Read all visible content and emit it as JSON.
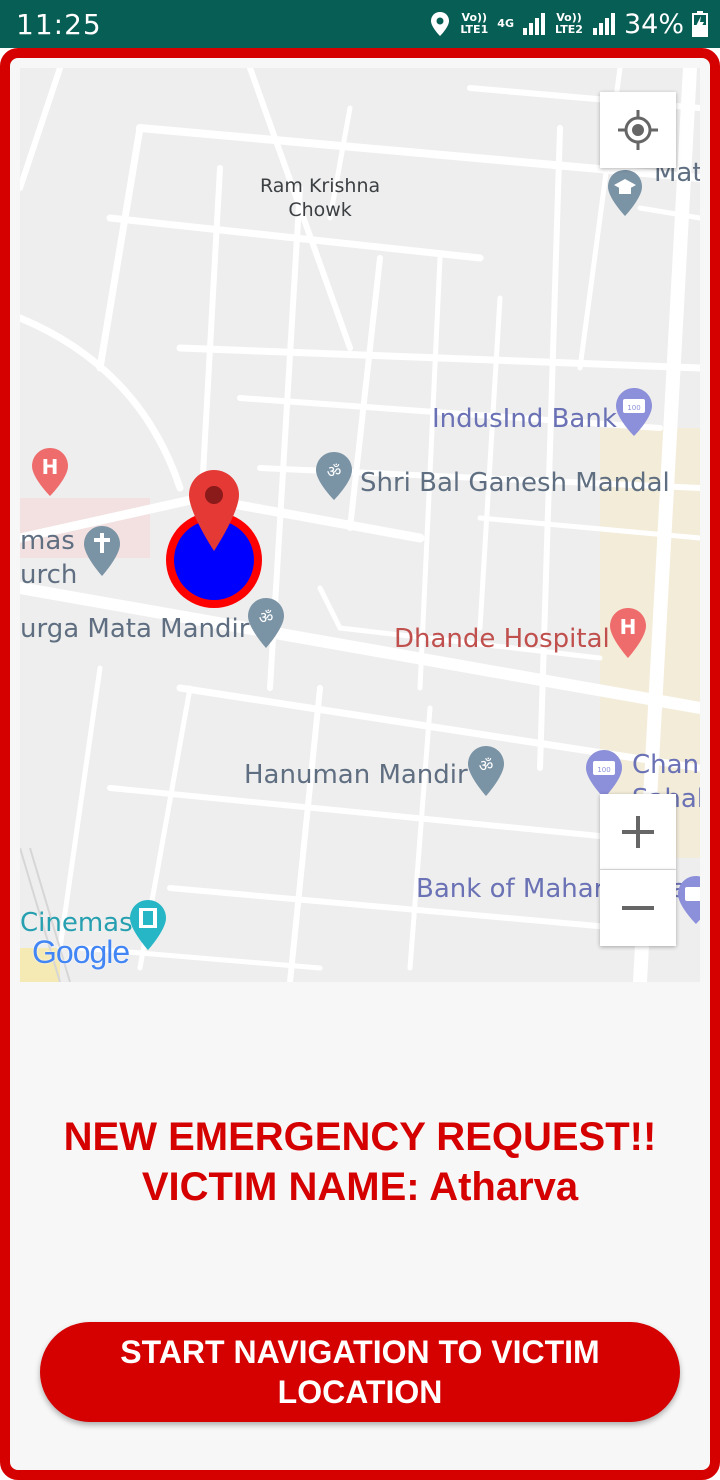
{
  "status_bar": {
    "time": "11:25",
    "sim1_label": "Vo)) LTE1",
    "network_type": "4G",
    "sim2_label": "Vo)) LTE2",
    "battery_percent": "34%"
  },
  "map": {
    "labels": {
      "ram_krishna_chowk": "Ram Krishna\nChowk",
      "mat": "Mat",
      "indusind_bank": "IndusInd Bank",
      "shri_bal_ganesh": "Shri Bal Ganesh Mandal",
      "church_line1": "mas",
      "church_line2": "urch",
      "durga_mata_mandir": "urga Mata Mandir",
      "dhande_hospital": "Dhande Hospital",
      "hanuman_mandir": "Hanuman Mandir",
      "chand_line1": "Chand",
      "chand_line2": "Sahak",
      "bank_of_maharashtra": "Bank of Maharashtra",
      "cinemas": "Cinemas",
      "google_logo": "Google"
    },
    "colors": {
      "marker_red": "#e53935",
      "target_fill": "#0000ff",
      "target_ring": "#ff0000",
      "hospital": "#ef6c6c",
      "poi_grey": "#7a93a5",
      "bank_blue": "#8c8fd9",
      "cinema_teal": "#26b6c6"
    }
  },
  "alert": {
    "line1": "NEW EMERGENCY REQUEST!!",
    "line2": "VICTIM NAME: Atharva"
  },
  "nav_button": {
    "label": "START NAVIGATION TO VICTIM LOCATION"
  },
  "theme": {
    "accent": "#d50000",
    "status_bar_bg": "#075e54"
  }
}
